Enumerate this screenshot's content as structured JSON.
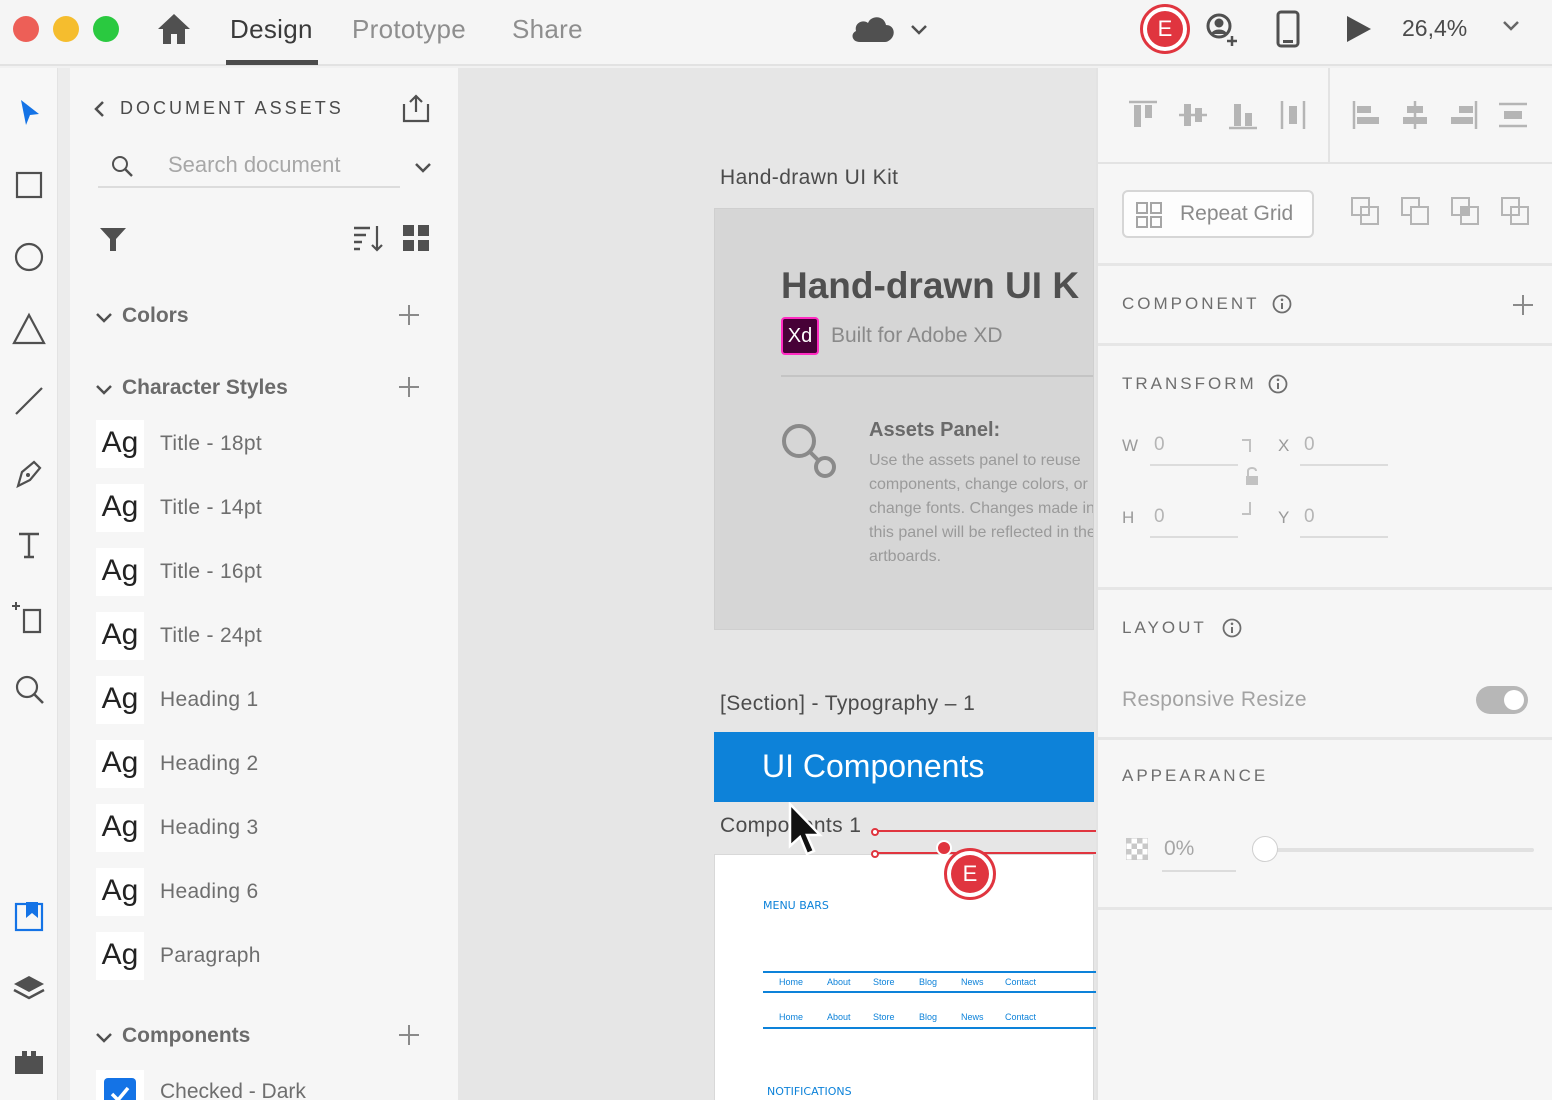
{
  "titlebar": {
    "tabs": [
      "Design",
      "Prototype",
      "Share"
    ],
    "active_tab": "Design",
    "collaborator_initial": "E",
    "zoom": "26,4%",
    "colors": {
      "accent_red": "#e0353f",
      "brand_blue": "#0d82d9"
    }
  },
  "toolbar": {
    "tools": [
      "select-tool",
      "rectangle-tool",
      "ellipse-tool",
      "polygon-tool",
      "line-tool",
      "pen-tool",
      "text-tool",
      "artboard-tool",
      "zoom-tool",
      "assets-tool",
      "layers-tool",
      "plugins-tool"
    ],
    "active_tool": "select-tool",
    "active_panel": "assets-tool"
  },
  "assets": {
    "header": "DOCUMENT ASSETS",
    "search_placeholder": "Search document",
    "sections": {
      "colors": "Colors",
      "character_styles": "Character Styles",
      "components": "Components"
    },
    "ag": "Ag",
    "character_styles": [
      "Title - 18pt",
      "Title - 14pt",
      "Title - 16pt",
      "Title - 24pt",
      "Heading 1",
      "Heading 2",
      "Heading 3",
      "Heading 6",
      "Paragraph"
    ],
    "components": [
      "Checked - Dark"
    ]
  },
  "canvas": {
    "artboard1_label": "Hand-drawn UI Kit",
    "kit_title": "Hand-drawn UI K",
    "xd_badge": "Xd",
    "built_for": "Built for Adobe XD",
    "assets_panel_title": "Assets Panel:",
    "assets_panel_body": "Use the assets panel to reuse components, change colors, or change fonts. Changes made in this panel will be reflected in the artboards.",
    "artboard2_label": "[Section] - Typography – 1",
    "ui_components": "UI Components",
    "artboard3_label": "Components 1",
    "menu_bars": "MENU BARS",
    "nav_items": [
      "Home",
      "About",
      "Store",
      "Blog",
      "News",
      "Contact"
    ],
    "notifications": "NOTIFICATIONS",
    "collaborator_initial": "E"
  },
  "props": {
    "repeat_grid": "Repeat Grid",
    "component_title": "COMPONENT",
    "transform_title": "TRANSFORM",
    "w_label": "W",
    "w_value": "0",
    "h_label": "H",
    "h_value": "0",
    "x_label": "X",
    "x_value": "0",
    "y_label": "Y",
    "y_value": "0",
    "layout_title": "LAYOUT",
    "responsive_resize": "Responsive Resize",
    "responsive_resize_on": true,
    "appearance_title": "APPEARANCE",
    "opacity": "0%"
  }
}
